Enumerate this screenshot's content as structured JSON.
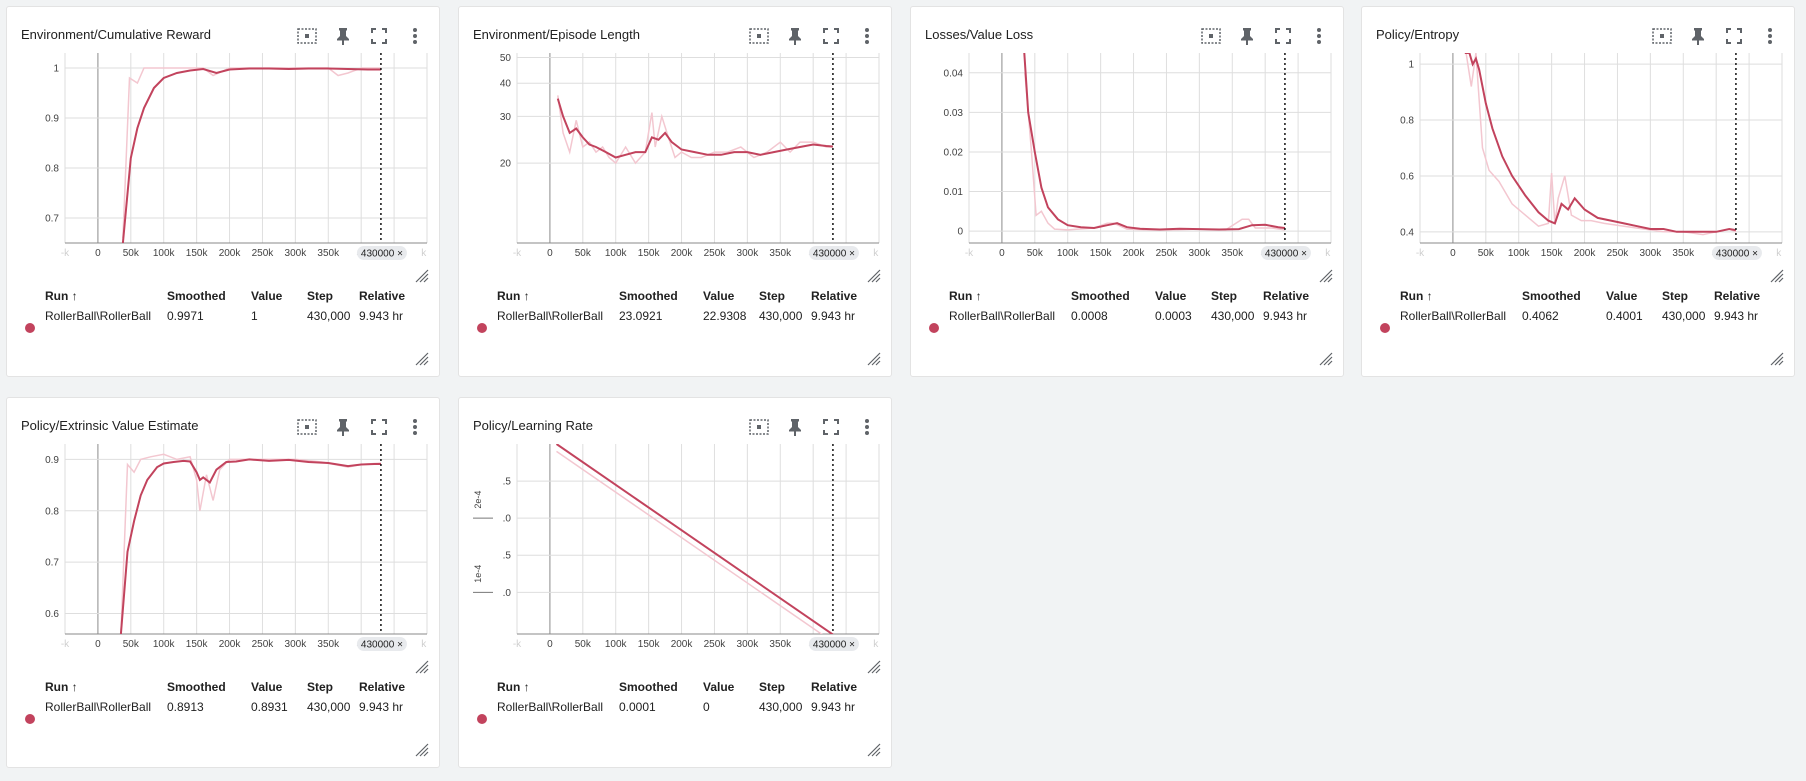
{
  "colors": {
    "smoothed": "#c2435d",
    "raw": "#f3c7d0",
    "grid": "#dedede",
    "axis": "#5f6368",
    "cursor_line": "#000000",
    "chip_bg": "#e8eaed",
    "background": "#f1f3f4"
  },
  "icons": [
    "fit-domain-icon",
    "pin-icon",
    "fullscreen-icon",
    "more-vert-icon",
    "resize-icon"
  ],
  "table_headers": {
    "run": "Run ↑",
    "smoothed": "Smoothed",
    "value": "Value",
    "step": "Step",
    "relative": "Relative"
  },
  "x_ticks": [
    "0",
    "50k",
    "100k",
    "150k",
    "200k",
    "250k",
    "300k",
    "350k",
    "4("
  ],
  "x_ticks_faded": {
    "left": "-k",
    "right": "k"
  },
  "cursor_chip": "430000 ×",
  "cards": [
    {
      "title": "Environment/Cumulative Reward",
      "run": "RollerBall\\RollerBall",
      "smoothed": "0.9971",
      "value": "1",
      "step": "430,000",
      "relative": "9.943 hr",
      "y_ticks": [
        "1",
        "0.9",
        "0.8",
        "0.7"
      ]
    },
    {
      "title": "Environment/Episode Length",
      "run": "RollerBall\\RollerBall",
      "smoothed": "23.0921",
      "value": "22.9308",
      "step": "430,000",
      "relative": "9.943 hr",
      "y_ticks": [
        "50",
        "40",
        "30",
        "20"
      ]
    },
    {
      "title": "Losses/Value Loss",
      "run": "RollerBall\\RollerBall",
      "smoothed": "0.0008",
      "value": "0.0003",
      "step": "430,000",
      "relative": "9.943 hr",
      "y_ticks": [
        "0.04",
        "0.03",
        "0.02",
        "0.01",
        "0"
      ]
    },
    {
      "title": "Policy/Entropy",
      "run": "RollerBall\\RollerBall",
      "smoothed": "0.4062",
      "value": "0.4001",
      "step": "430,000",
      "relative": "9.943 hr",
      "y_ticks": [
        "1",
        "0.8",
        "0.6",
        "0.4"
      ]
    },
    {
      "title": "Policy/Extrinsic Value Estimate",
      "run": "RollerBall\\RollerBall",
      "smoothed": "0.8913",
      "value": "0.8931",
      "step": "430,000",
      "relative": "9.943 hr",
      "y_ticks": [
        "0.9",
        "0.8",
        "0.7",
        "0.6"
      ]
    },
    {
      "title": "Policy/Learning Rate",
      "run": "RollerBall\\RollerBall",
      "smoothed": "0.0001",
      "value": "0",
      "step": "430,000",
      "relative": "9.943 hr",
      "y_ticks": [
        ".5",
        ".0",
        ".5",
        ".0"
      ],
      "y_group_labels": [
        "2e-4",
        "1e-4"
      ]
    }
  ],
  "chart_data": [
    {
      "type": "line",
      "title": "Environment/Cumulative Reward",
      "x_ticks": [
        "0",
        "50k",
        "100k",
        "150k",
        "200k",
        "250k",
        "300k",
        "350k"
      ],
      "ylim": [
        0.65,
        1.03
      ],
      "series": [
        {
          "x": [
            38000,
            50000,
            60000,
            70000,
            85000,
            100000,
            120000,
            140000,
            160000,
            180000,
            200000,
            230000,
            260000,
            290000,
            320000,
            350000,
            380000,
            410000,
            430000
          ],
          "values": [
            0.65,
            0.82,
            0.88,
            0.92,
            0.96,
            0.98,
            0.99,
            0.995,
            0.998,
            0.99,
            0.997,
            0.999,
            0.999,
            0.998,
            0.999,
            0.999,
            0.998,
            0.997,
            0.997
          ]
        },
        {
          "x": [
            38000,
            48000,
            60000,
            70000,
            80000,
            100000,
            140000,
            160000,
            175000,
            200000,
            250000,
            300000,
            350000,
            365000,
            380000,
            400000,
            430000
          ],
          "values": [
            0.66,
            0.98,
            0.97,
            1.0,
            1.0,
            1.0,
            1.0,
            1.0,
            0.985,
            1.0,
            1.0,
            1.0,
            1.0,
            0.985,
            0.99,
            1.0,
            1.0
          ]
        }
      ]
    },
    {
      "type": "line",
      "title": "Environment/Episode Length",
      "x_ticks": [
        "0",
        "50k",
        "100k",
        "150k",
        "200k",
        "250k",
        "300k",
        "350k"
      ],
      "ylim": [
        10,
        50
      ],
      "series": [
        {
          "x": [
            12000,
            20000,
            30000,
            40000,
            50000,
            60000,
            70000,
            85000,
            100000,
            115000,
            130000,
            145000,
            155000,
            165000,
            175000,
            185000,
            200000,
            220000,
            240000,
            260000,
            280000,
            300000,
            320000,
            340000,
            360000,
            380000,
            400000,
            420000,
            430000
          ],
          "values": [
            35,
            30,
            26,
            27,
            25,
            23.5,
            23,
            22,
            21,
            21.5,
            22,
            22,
            25,
            24.5,
            26,
            24,
            22.5,
            22,
            21.5,
            21.5,
            22,
            22,
            21.5,
            22,
            22.5,
            23,
            23.5,
            23.2,
            23.1
          ]
        },
        {
          "x": [
            12000,
            20000,
            30000,
            40000,
            50000,
            60000,
            70000,
            80000,
            90000,
            100000,
            115000,
            130000,
            145000,
            155000,
            160000,
            170000,
            180000,
            190000,
            200000,
            215000,
            230000,
            250000,
            270000,
            290000,
            310000,
            330000,
            350000,
            365000,
            380000,
            400000,
            420000,
            430000
          ],
          "values": [
            36,
            26,
            22,
            29,
            23,
            24,
            22,
            23,
            21,
            20,
            23,
            20,
            22,
            31,
            23,
            30,
            25,
            21,
            22,
            21,
            21,
            22,
            22,
            23,
            21,
            22,
            24,
            22,
            24,
            24,
            23,
            23
          ]
        }
      ]
    },
    {
      "type": "line",
      "title": "Losses/Value Loss",
      "x_ticks": [
        "0",
        "50k",
        "100k",
        "150k",
        "200k",
        "250k",
        "300k",
        "350k"
      ],
      "ylim": [
        -0.003,
        0.045
      ],
      "series": [
        {
          "x": [
            32000,
            40000,
            50000,
            60000,
            70000,
            85000,
            100000,
            120000,
            140000,
            160000,
            175000,
            190000,
            210000,
            240000,
            270000,
            300000,
            330000,
            360000,
            380000,
            400000,
            420000,
            430000
          ],
          "values": [
            0.05,
            0.03,
            0.02,
            0.011,
            0.006,
            0.003,
            0.0015,
            0.001,
            0.0008,
            0.0015,
            0.002,
            0.001,
            0.0006,
            0.0004,
            0.0006,
            0.0005,
            0.0004,
            0.0005,
            0.0015,
            0.0016,
            0.001,
            0.0008
          ]
        },
        {
          "x": [
            35000,
            45000,
            52000,
            60000,
            70000,
            80000,
            100000,
            140000,
            160000,
            170000,
            190000,
            220000,
            260000,
            300000,
            340000,
            365000,
            375000,
            385000,
            410000,
            430000
          ],
          "values": [
            0.04,
            0.02,
            0.004,
            0.005,
            0.002,
            0.0005,
            0.0003,
            0.0008,
            0.002,
            0.002,
            0.0005,
            0.0003,
            0.0003,
            0.0005,
            0.0003,
            0.003,
            0.003,
            0.0008,
            0.0008,
            0.0003
          ]
        }
      ]
    },
    {
      "type": "line",
      "title": "Policy/Entropy",
      "x_ticks": [
        "0",
        "50k",
        "100k",
        "150k",
        "200k",
        "250k",
        "300k",
        "350k"
      ],
      "ylim": [
        0.36,
        1.04
      ],
      "series": [
        {
          "x": [
            18000,
            25000,
            30000,
            35000,
            40000,
            50000,
            60000,
            75000,
            90000,
            110000,
            130000,
            145000,
            155000,
            165000,
            175000,
            185000,
            200000,
            220000,
            240000,
            260000,
            280000,
            300000,
            320000,
            340000,
            360000,
            380000,
            400000,
            420000,
            430000
          ],
          "values": [
            1.04,
            1.04,
            1.0,
            1.02,
            0.98,
            0.86,
            0.77,
            0.67,
            0.6,
            0.53,
            0.47,
            0.44,
            0.43,
            0.5,
            0.48,
            0.52,
            0.48,
            0.45,
            0.44,
            0.43,
            0.42,
            0.41,
            0.41,
            0.4,
            0.4,
            0.4,
            0.4,
            0.41,
            0.406
          ]
        },
        {
          "x": [
            20000,
            28000,
            35000,
            45000,
            55000,
            70000,
            90000,
            110000,
            130000,
            145000,
            150000,
            155000,
            160000,
            170000,
            180000,
            195000,
            210000,
            230000,
            260000,
            290000,
            320000,
            350000,
            380000,
            400000,
            420000,
            430000
          ],
          "values": [
            1.04,
            0.92,
            1.04,
            0.7,
            0.62,
            0.58,
            0.5,
            0.46,
            0.42,
            0.43,
            0.61,
            0.43,
            0.52,
            0.6,
            0.46,
            0.44,
            0.44,
            0.43,
            0.42,
            0.41,
            0.4,
            0.4,
            0.39,
            0.4,
            0.41,
            0.4
          ]
        }
      ]
    },
    {
      "type": "line",
      "title": "Policy/Extrinsic Value Estimate",
      "x_ticks": [
        "0",
        "50k",
        "100k",
        "150k",
        "200k",
        "250k",
        "300k",
        "350k"
      ],
      "ylim": [
        0.56,
        0.93
      ],
      "series": [
        {
          "x": [
            35000,
            45000,
            55000,
            65000,
            75000,
            90000,
            100000,
            115000,
            130000,
            140000,
            150000,
            155000,
            160000,
            170000,
            180000,
            195000,
            210000,
            230000,
            260000,
            290000,
            320000,
            350000,
            380000,
            400000,
            420000,
            430000
          ],
          "values": [
            0.56,
            0.72,
            0.78,
            0.83,
            0.86,
            0.885,
            0.892,
            0.895,
            0.897,
            0.896,
            0.875,
            0.86,
            0.865,
            0.855,
            0.88,
            0.895,
            0.896,
            0.9,
            0.897,
            0.899,
            0.895,
            0.893,
            0.887,
            0.89,
            0.891,
            0.891
          ]
        },
        {
          "x": [
            35000,
            45000,
            55000,
            65000,
            80000,
            100000,
            120000,
            140000,
            150000,
            155000,
            165000,
            175000,
            185000,
            200000,
            230000,
            260000,
            300000,
            340000,
            380000,
            400000,
            430000
          ],
          "values": [
            0.56,
            0.89,
            0.875,
            0.9,
            0.905,
            0.91,
            0.9,
            0.905,
            0.86,
            0.8,
            0.87,
            0.82,
            0.88,
            0.9,
            0.9,
            0.9,
            0.9,
            0.895,
            0.885,
            0.89,
            0.893
          ]
        }
      ]
    },
    {
      "type": "line",
      "title": "Policy/Learning Rate",
      "x_ticks": [
        "0",
        "50k",
        "100k",
        "150k",
        "200k",
        "250k",
        "300k",
        "350k"
      ],
      "ylim": [
        4.38e-05,
        0.0003
      ],
      "series": [
        {
          "x": [
            10000,
            435000
          ],
          "values": [
            0.0003,
            4e-05
          ]
        },
        {
          "x": [
            10000,
            435000
          ],
          "values": [
            0.00029,
            3e-05
          ]
        }
      ]
    }
  ]
}
